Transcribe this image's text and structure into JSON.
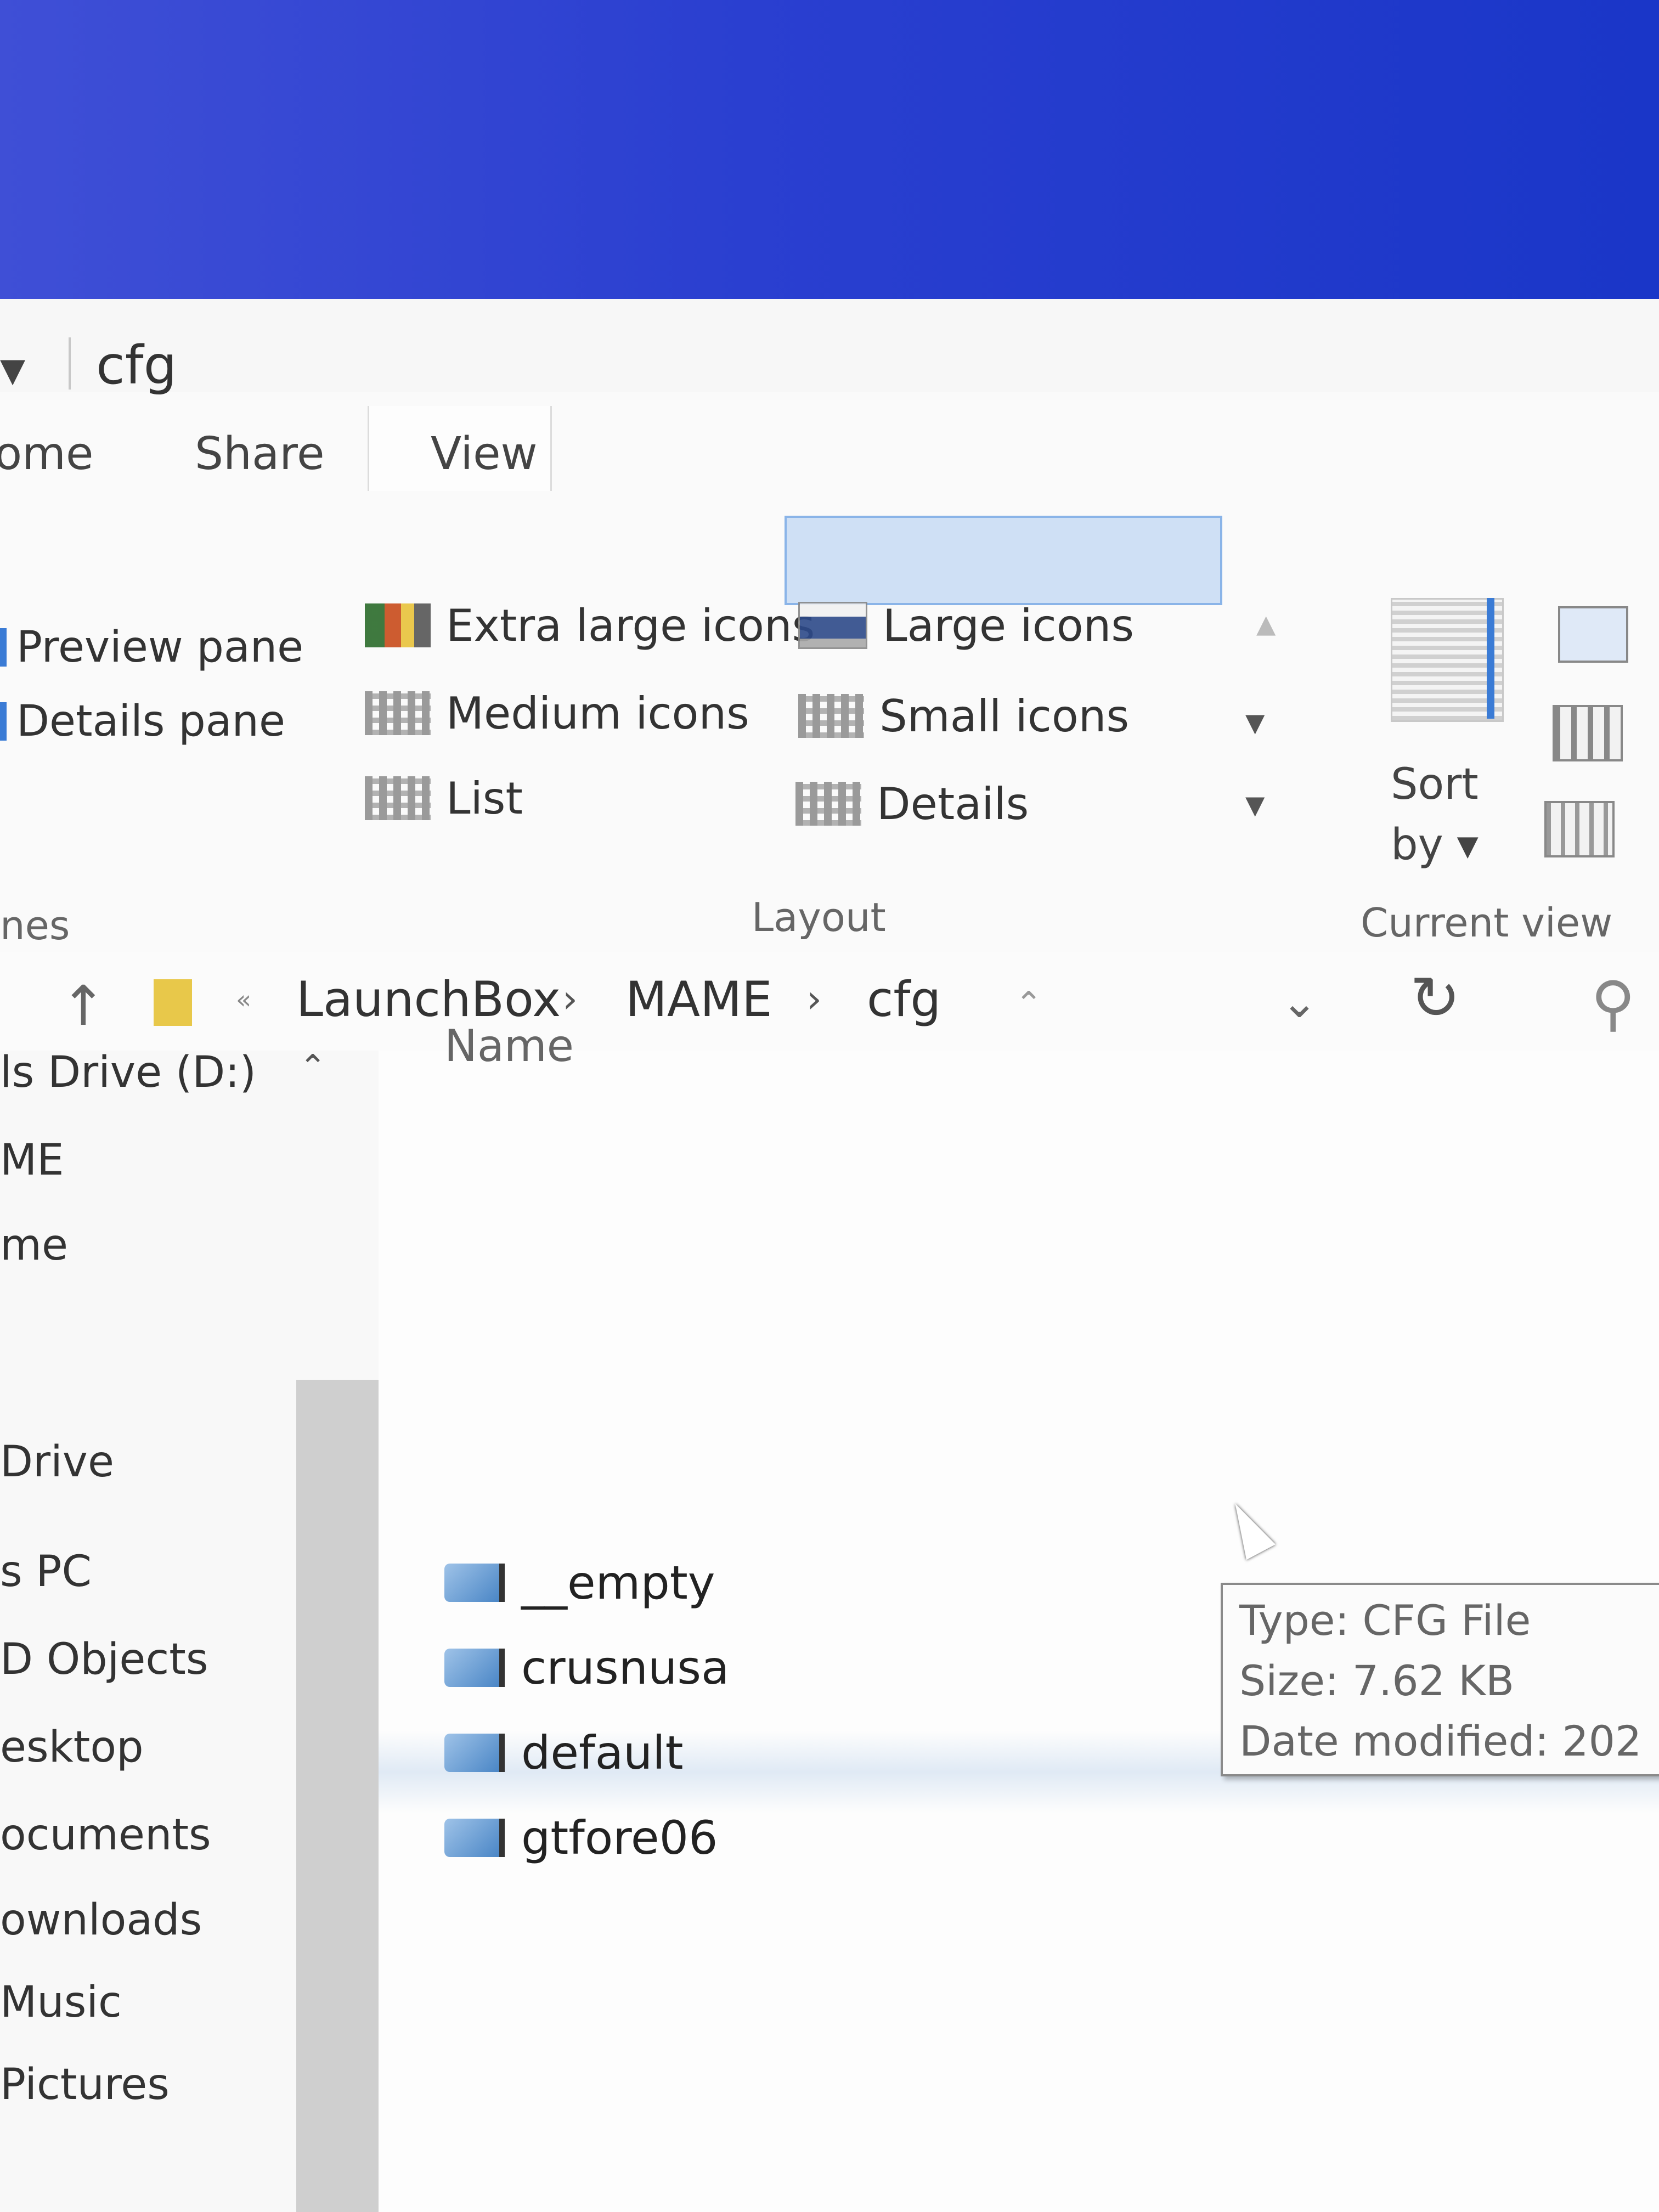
{
  "window": {
    "title": "cfg"
  },
  "ribbon": {
    "tabs": [
      {
        "label": "ome"
      },
      {
        "label": "Share"
      },
      {
        "label": "View"
      }
    ],
    "panes": {
      "preview_label": "Preview pane",
      "details_label": "Details pane",
      "group_label": "nes"
    },
    "layout": {
      "options": {
        "extra_large": "Extra large icons",
        "large": "Large icons",
        "medium": "Medium icons",
        "small": "Small icons",
        "list": "List",
        "details": "Details"
      },
      "selected": "Details",
      "group_label": "Layout"
    },
    "current_view": {
      "sort_by_line1": "Sort",
      "sort_by_line2": "by ▾",
      "group_label": "Current view"
    }
  },
  "address": {
    "more": "«",
    "crumbs": [
      "LaunchBox",
      "MAME",
      "cfg"
    ],
    "separator": "›"
  },
  "navigation": {
    "items": [
      "ls Drive (D:)",
      "ME",
      "me",
      "Drive",
      "s PC",
      "D Objects",
      "esktop",
      "ocuments",
      "ownloads",
      "Music",
      "Pictures"
    ]
  },
  "file_list": {
    "column_name": "Name",
    "files": [
      "__empty",
      "crusnusa",
      "default",
      "gtfore06"
    ]
  },
  "tooltip": {
    "type": "Type: CFG File",
    "size": "Size: 7.62 KB",
    "date": "Date modified: 202"
  },
  "colors": {
    "desktop_blue": "#2a3fd0",
    "selection": "#cfe0f5",
    "accent": "#3a7bd5"
  }
}
